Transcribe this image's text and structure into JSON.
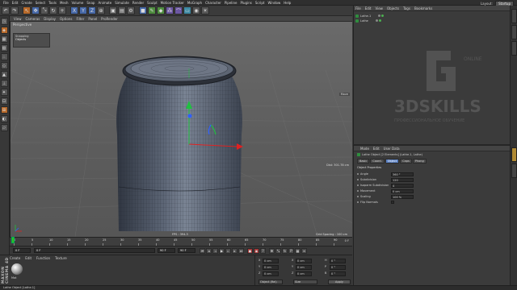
{
  "menubar": {
    "items": [
      "File",
      "Edit",
      "Create",
      "Select",
      "Tools",
      "Mesh",
      "Volume",
      "Snap",
      "Animate",
      "Simulate",
      "Render",
      "Sculpt",
      "Motion Tracker",
      "MoGraph",
      "Character",
      "Pipeline",
      "Plugins",
      "Script",
      "Window",
      "Help"
    ],
    "layout_label": "Layout:",
    "layout_value": "Startup"
  },
  "viewport": {
    "menu": [
      "View",
      "Cameras",
      "Display",
      "Options",
      "Filter",
      "Panel",
      "ProRender"
    ],
    "label": "Perspective",
    "snap_title": "Snapping",
    "snap_value": "Objects",
    "move_label": "Move",
    "size_label": "Dist: 301.78 cm",
    "fps": "FPS : 394.3",
    "grid_spacing": "Grid Spacing : 100 cm"
  },
  "timeline": {
    "ticks": [
      "0",
      "5",
      "10",
      "15",
      "20",
      "25",
      "30",
      "35",
      "40",
      "45",
      "50",
      "55",
      "60",
      "65",
      "70",
      "75",
      "80",
      "85",
      "90"
    ],
    "frame_end": "0 F"
  },
  "transport": {
    "start": "0 F",
    "current": "0 F",
    "end": "90 F",
    "max": "90 F"
  },
  "materials": {
    "menu": [
      "Create",
      "Edit",
      "Function",
      "Texture"
    ],
    "name": "Mat",
    "brand": "MAXON CINEMA 4D"
  },
  "coordinates": {
    "rows": [
      {
        "axis": "X",
        "pos": "0 cm",
        "axis2": "X",
        "size": "0 cm",
        "axis3": "H",
        "rot": "0 °"
      },
      {
        "axis": "Y",
        "pos": "0 cm",
        "axis2": "Y",
        "size": "0 cm",
        "axis3": "P",
        "rot": "0 °"
      },
      {
        "axis": "Z",
        "pos": "0 cm",
        "axis2": "Z",
        "size": "0 cm",
        "axis3": "B",
        "rot": "0 °"
      }
    ],
    "mode": "Object (Rel)",
    "size_mode": "Size",
    "apply": "Apply"
  },
  "status": "Lathe Object [Lathe.1]",
  "object_manager": {
    "menu": [
      "File",
      "Edit",
      "View",
      "Objects",
      "Tags",
      "Bookmarks"
    ],
    "objects": [
      {
        "name": "Lathe.1"
      },
      {
        "name": "Lathe"
      }
    ],
    "watermark_text": "3DSKILLS",
    "watermark_sub": "ПРОФЕССИОНАЛЬНОЕ ОБУЧЕНИЕ",
    "watermark_online": "ONLINE"
  },
  "attributes": {
    "menu": [
      "Mode",
      "Edit",
      "User Data"
    ],
    "title": "Lathe Object [2 Elements] (Lathe.1, Lathe)",
    "tabs": [
      "Basic",
      "Coord.",
      "Object",
      "Caps",
      "Phong"
    ],
    "active_tab": "Object",
    "section": "Object Properties",
    "props": [
      {
        "label": "Angle",
        "value": "360 °"
      },
      {
        "label": "Subdivision",
        "value": "120"
      },
      {
        "label": "Isoparm Subdivision",
        "value": "4"
      },
      {
        "label": "Movement",
        "value": "0 cm"
      },
      {
        "label": "Scaling",
        "value": "100 %"
      },
      {
        "label": "Flip Normals",
        "value": ""
      }
    ]
  },
  "colors": {
    "accent_blue": "#5a7fc0",
    "playhead_green": "#30c020",
    "object_green": "#2f8d3e",
    "axis_red": "#e02020",
    "axis_green": "#20c040",
    "axis_blue": "#3060ff"
  }
}
